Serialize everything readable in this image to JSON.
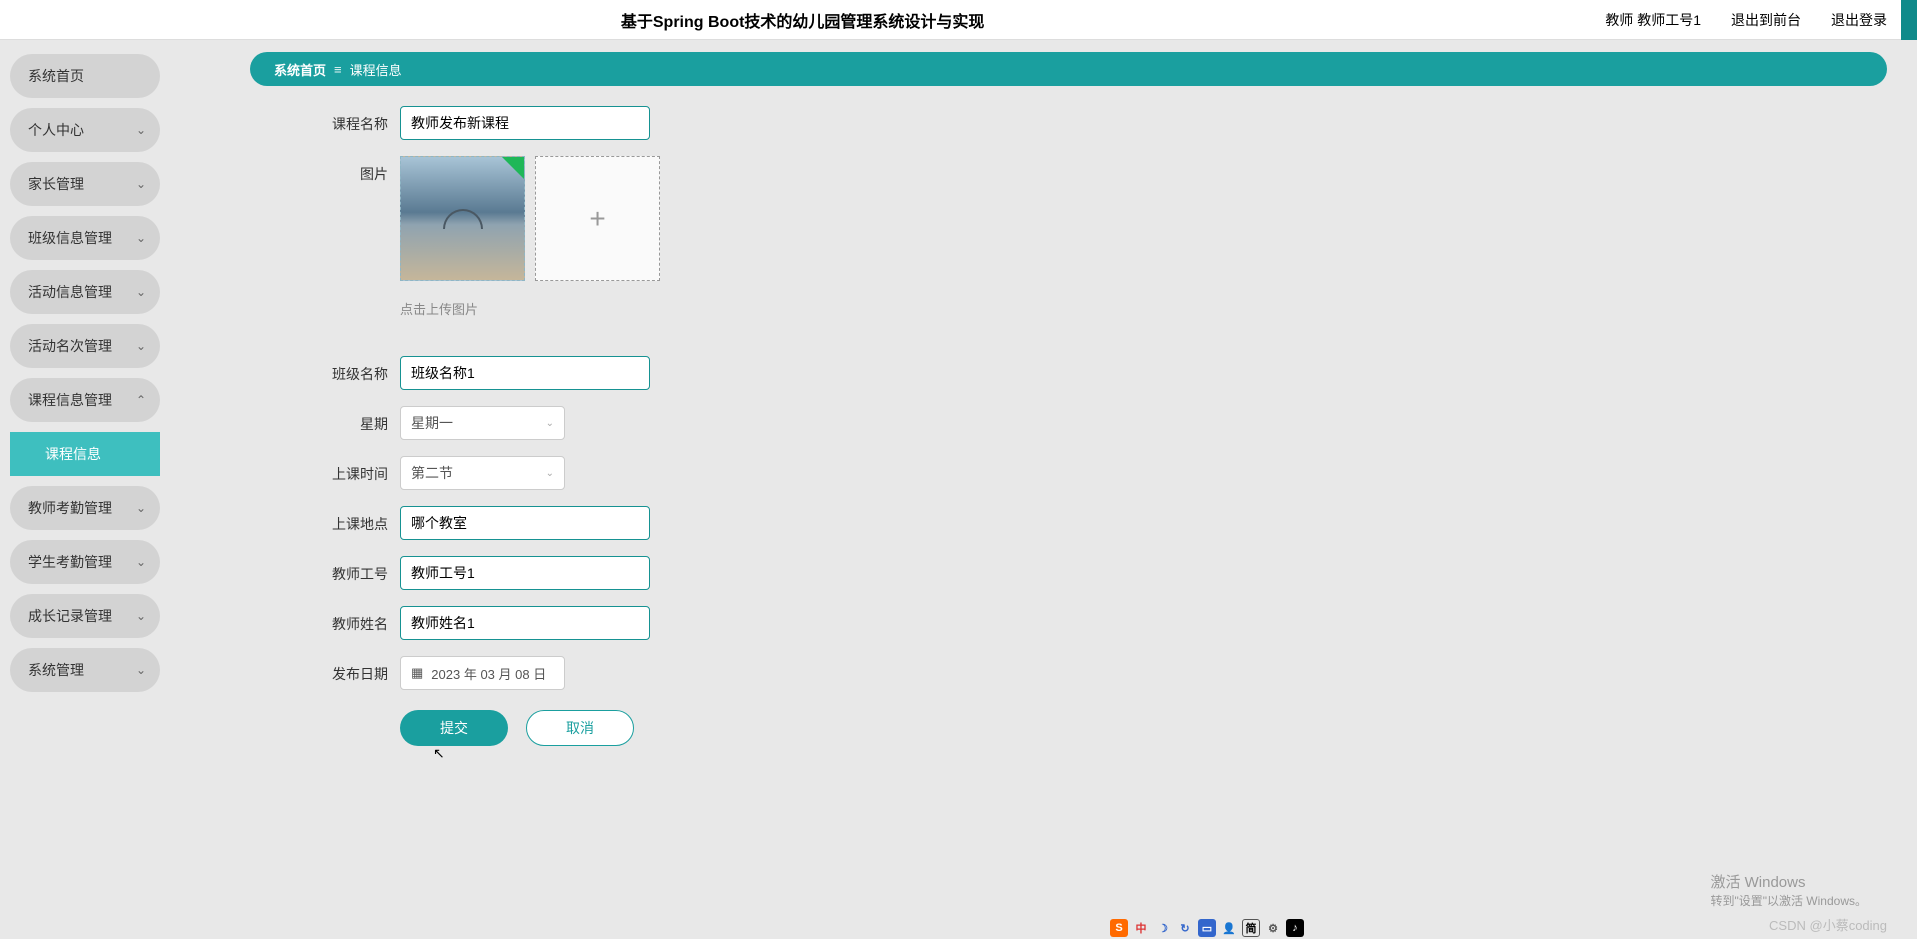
{
  "header": {
    "title": "基于Spring Boot技术的幼儿园管理系统设计与实现",
    "user": "教师 教师工号1",
    "logout_front": "退出到前台",
    "logout": "退出登录"
  },
  "breadcrumb": {
    "home": "系统首页",
    "current": "课程信息"
  },
  "sidebar": {
    "items": [
      {
        "label": "系统首页",
        "expand": false,
        "chev": ""
      },
      {
        "label": "个人中心",
        "expand": true,
        "chev": "⌄"
      },
      {
        "label": "家长管理",
        "expand": true,
        "chev": "⌄"
      },
      {
        "label": "班级信息管理",
        "expand": true,
        "chev": "⌄"
      },
      {
        "label": "活动信息管理",
        "expand": true,
        "chev": "⌄"
      },
      {
        "label": "活动名次管理",
        "expand": true,
        "chev": "⌄"
      },
      {
        "label": "课程信息管理",
        "expand": true,
        "chev": "⌃",
        "open": true
      },
      {
        "label": "课程信息",
        "sub": true
      },
      {
        "label": "教师考勤管理",
        "expand": true,
        "chev": "⌄"
      },
      {
        "label": "学生考勤管理",
        "expand": true,
        "chev": "⌄"
      },
      {
        "label": "成长记录管理",
        "expand": true,
        "chev": "⌄"
      },
      {
        "label": "系统管理",
        "expand": true,
        "chev": "⌄"
      }
    ]
  },
  "form": {
    "course_name": {
      "label": "课程名称",
      "value": "教师发布新课程"
    },
    "image": {
      "label": "图片",
      "hint": "点击上传图片"
    },
    "class_name": {
      "label": "班级名称",
      "value": "班级名称1"
    },
    "weekday": {
      "label": "星期",
      "value": "星期一"
    },
    "time": {
      "label": "上课时间",
      "value": "第二节"
    },
    "place": {
      "label": "上课地点",
      "value": "哪个教室"
    },
    "teacher_id": {
      "label": "教师工号",
      "value": "教师工号1"
    },
    "teacher_name": {
      "label": "教师姓名",
      "value": "教师姓名1"
    },
    "pub_date": {
      "label": "发布日期",
      "value": "2023 年 03 月 08 日"
    },
    "submit": "提交",
    "cancel": "取消"
  },
  "watermark": {
    "line1": "激活 Windows",
    "line2": "转到\"设置\"以激活 Windows。"
  },
  "csdn": "CSDN @小蔡coding",
  "tray": {
    "t1": "中",
    "t2": "简"
  }
}
